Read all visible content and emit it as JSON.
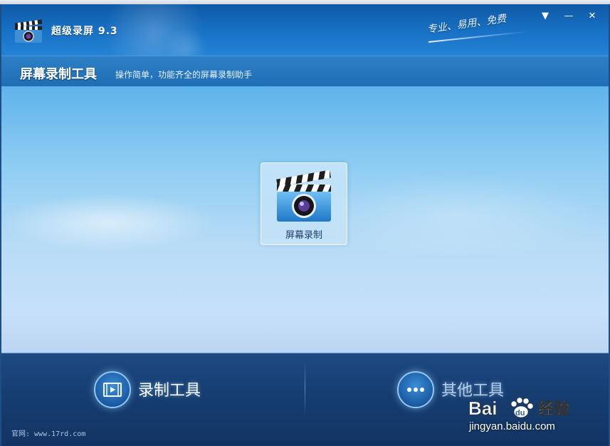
{
  "window": {
    "title": "超级录屏 9.3",
    "slogan": "专业、易用、免费",
    "controls": {
      "menu": "▼",
      "minimize": "—",
      "close": "✕"
    }
  },
  "subheader": {
    "title": "屏幕录制工具",
    "description": "操作简单，功能齐全的屏幕录制助手"
  },
  "tools": [
    {
      "label": "屏幕录制",
      "icon": "clapperboard-camera-icon"
    }
  ],
  "bottom_nav": [
    {
      "label": "录制工具",
      "icon": "film-icon",
      "active": true
    },
    {
      "label": "其他工具",
      "icon": "more-dots-icon",
      "active": false
    }
  ],
  "footer": {
    "site": "官网: www.17rd.com"
  },
  "watermark": {
    "brand_left": "Bai",
    "brand_right": "经验",
    "du": "du",
    "url": "jingyan.baidu.com"
  },
  "colors": {
    "titlebar": "#1872c6",
    "content_top": "#5fb3ec",
    "bottom_bar": "#163d70"
  }
}
